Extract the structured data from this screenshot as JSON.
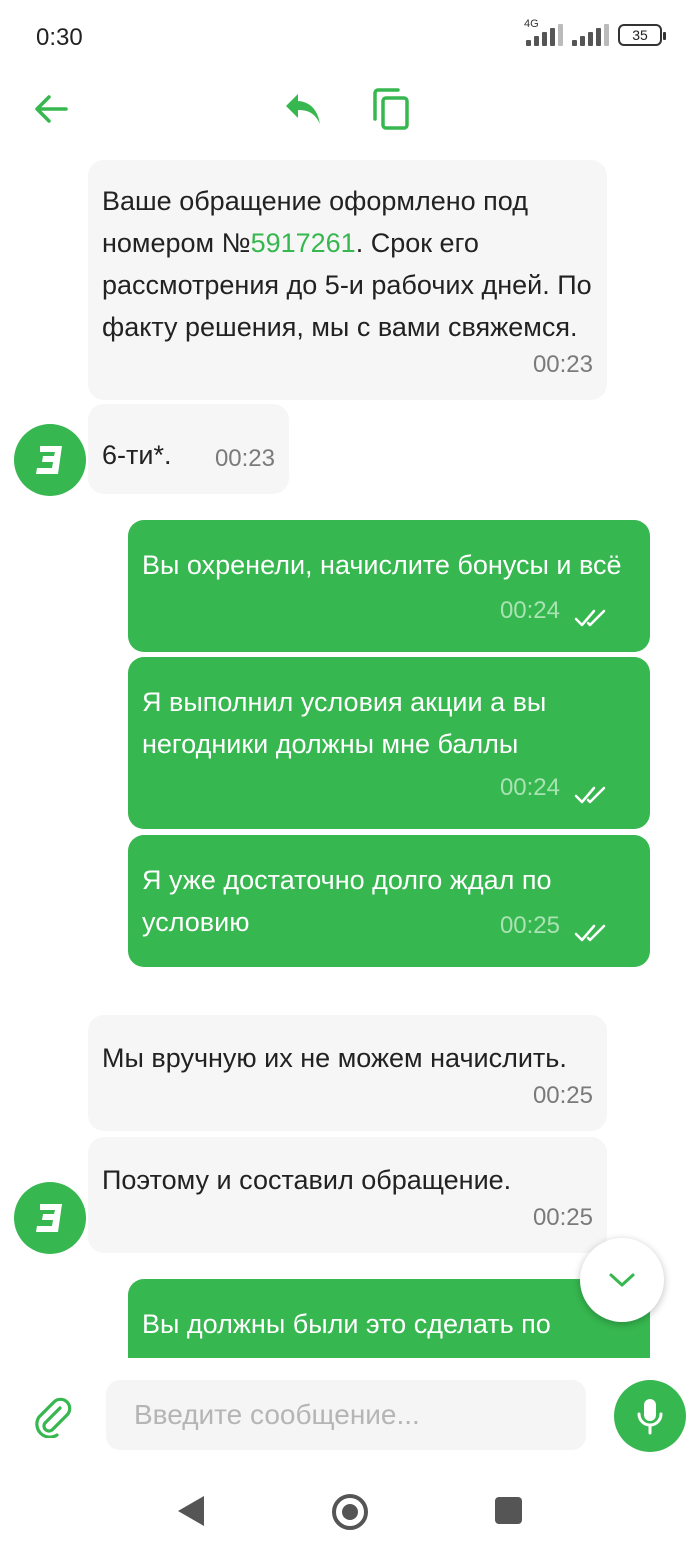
{
  "status_bar": {
    "time": "0:30",
    "network": "4G",
    "battery": "35"
  },
  "header": {
    "back_icon": "arrow-left-icon",
    "reply_icon": "reply-icon",
    "copy_icon": "copy-icon"
  },
  "messages": [
    {
      "direction": "incoming",
      "text_before": "Ваше обращение оформлено под номером №",
      "link": "5917261",
      "text_after": ". Срок его рассмотрения до 5-и рабочих дней. По факту решения, мы с вами свяжемся.",
      "time": "00:23"
    },
    {
      "direction": "incoming",
      "text": "6-ти*.",
      "time": "00:23"
    },
    {
      "direction": "outgoing",
      "text": "Вы охренели, начислите бонусы и всё",
      "time": "00:24"
    },
    {
      "direction": "outgoing",
      "text": "Я выполнил условия акции а вы негодники должны мне баллы",
      "time": "00:24"
    },
    {
      "direction": "outgoing",
      "text": "Я уже достаточно долго ждал по условию",
      "time": "00:25"
    },
    {
      "direction": "incoming",
      "text": "Мы вручную их не можем начислить.",
      "time": "00:25"
    },
    {
      "direction": "incoming",
      "text": "Поэтому и составил обращение.",
      "time": "00:25"
    },
    {
      "direction": "outgoing",
      "text": "Вы должны были это сделать по"
    }
  ],
  "input": {
    "placeholder": "Введите сообщение..."
  },
  "colors": {
    "accent": "#36b74f",
    "incoming_bubble": "#f6f6f6",
    "outgoing_bubble": "#36b74f"
  }
}
